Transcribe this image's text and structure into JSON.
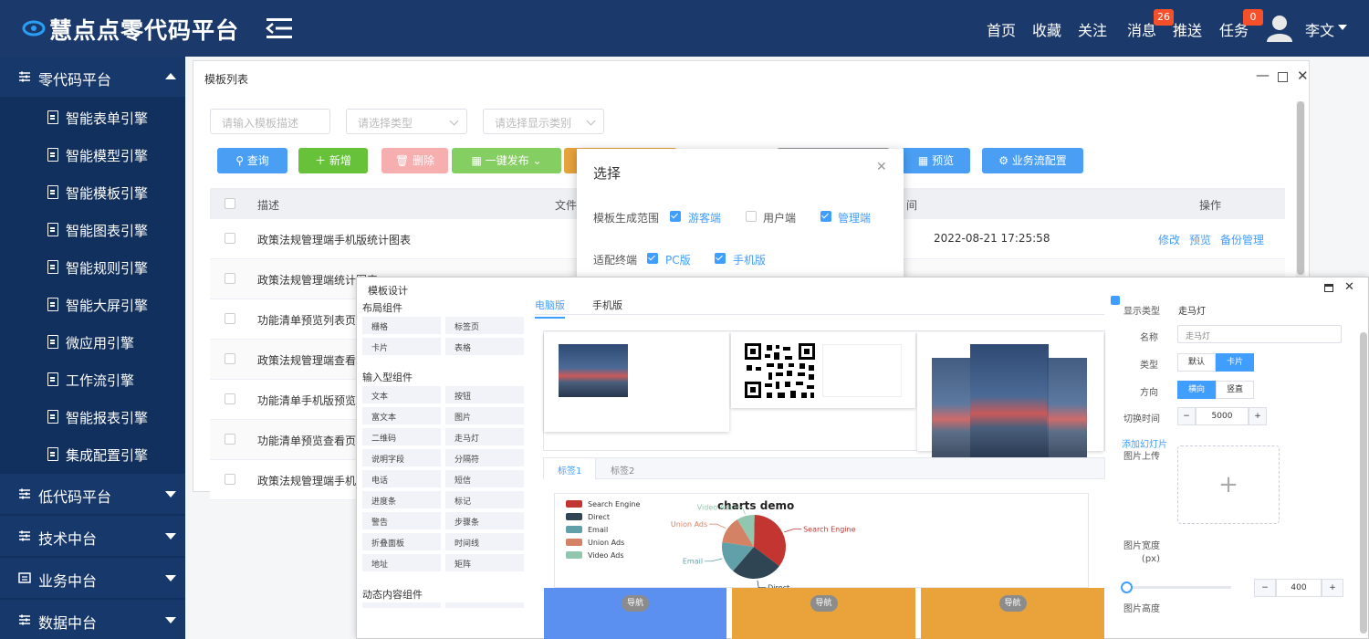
{
  "header": {
    "app_title": "慧点点零代码平台",
    "nav": [
      "首页",
      "收藏",
      "关注",
      "消息",
      "推送",
      "任务"
    ],
    "message_badge": "26",
    "task_badge": "0",
    "user_name": "李文",
    "brand_color": "#1b3a6b"
  },
  "sidebar": {
    "groups": [
      {
        "label": "零代码平台",
        "icon": "sliders-icon",
        "expanded": true
      },
      {
        "label": "低代码平台",
        "icon": "sliders-icon",
        "expanded": false
      },
      {
        "label": "技术中台",
        "icon": "sliders-icon",
        "expanded": false
      },
      {
        "label": "业务中台",
        "icon": "window-icon",
        "expanded": false
      },
      {
        "label": "数据中台",
        "icon": "sliders-icon",
        "expanded": false
      }
    ],
    "items": [
      "智能表单引擎",
      "智能模型引擎",
      "智能模板引擎",
      "智能图表引擎",
      "智能规则引擎",
      "智能大屏引擎",
      "微应用引擎",
      "工作流引擎",
      "智能报表引擎",
      "集成配置引擎"
    ]
  },
  "template_list": {
    "title": "模板列表",
    "filters": {
      "desc_placeholder": "请输入模板描述",
      "type_placeholder": "请选择类型",
      "category_placeholder": "请选择显示类别"
    },
    "buttons": {
      "query": "查询",
      "add": "新增",
      "delete": "删除",
      "publish": "一键发布",
      "preview": "预览",
      "flow": "业务流配置"
    },
    "columns": {
      "desc": "描述",
      "file": "文件",
      "time": "间",
      "ops": "操作"
    },
    "rows": [
      {
        "desc": "政策法规管理端手机版统计图表",
        "time": "2022-08-21 17:25:58",
        "ops": [
          "修改",
          "预览",
          "备份管理"
        ]
      },
      {
        "desc": "政策法规管理端统计图表",
        "time": "",
        "ops": []
      },
      {
        "desc": "功能清单预览列表页",
        "time": "",
        "ops": []
      },
      {
        "desc": "政策法规管理端查看",
        "time": "",
        "ops": []
      },
      {
        "desc": "功能清单手机版预览",
        "time": "",
        "ops": []
      },
      {
        "desc": "功能清单预览查看页",
        "time": "",
        "ops": []
      },
      {
        "desc": "政策法规管理端手机",
        "time": "",
        "ops": []
      }
    ]
  },
  "select_dialog": {
    "title": "选择",
    "scope_label": "模板生成范围",
    "scope_options": [
      {
        "label": "游客端",
        "checked": true
      },
      {
        "label": "用户端",
        "checked": false
      },
      {
        "label": "管理端",
        "checked": true
      }
    ],
    "terminal_label": "适配终端",
    "terminal_options": [
      {
        "label": "PC版",
        "checked": true
      },
      {
        "label": "手机版",
        "checked": true
      }
    ]
  },
  "designer": {
    "title": "模板设计",
    "layout_section": "布局组件",
    "layout_items": [
      "栅格",
      "标签页",
      "卡片",
      "表格"
    ],
    "input_section": "输入型组件",
    "input_items": [
      "文本",
      "按钮",
      "富文本",
      "图片",
      "二维码",
      "走马灯",
      "说明字段",
      "分隔符",
      "电话",
      "短信",
      "进度条",
      "标记",
      "警告",
      "步骤条",
      "折叠面板",
      "时间线",
      "地址",
      "矩阵"
    ],
    "dynamic_section": "动态内容组件",
    "canvas_tabs": [
      "电脑版",
      "手机版"
    ],
    "inner_tabs": [
      "标签1",
      "标签2"
    ],
    "nav_label": "导航",
    "props": {
      "display_type_label": "显示类型",
      "display_type_value": "走马灯",
      "name_label": "名称",
      "name_value": "走马灯",
      "type_label": "类型",
      "type_options": [
        "默认",
        "卡片"
      ],
      "direction_label": "方向",
      "direction_options": [
        "横向",
        "竖直"
      ],
      "interval_label": "切换时间",
      "interval_value": "5000",
      "add_slide": "添加幻灯片",
      "upload_label": "图片上传",
      "width_label": "图片宽度",
      "width_unit": "(px)",
      "width_value": "400",
      "height_label": "图片高度"
    }
  },
  "chart_data": {
    "type": "pie",
    "title": "charts demo",
    "categories": [
      "Search Engine",
      "Direct",
      "Email",
      "Union Ads",
      "Video Ads"
    ],
    "values": [
      35,
      26,
      16,
      14,
      9
    ],
    "colors": [
      "#c23531",
      "#2f4554",
      "#61a0a8",
      "#d48265",
      "#91c7ae"
    ],
    "legend": "top-left"
  }
}
